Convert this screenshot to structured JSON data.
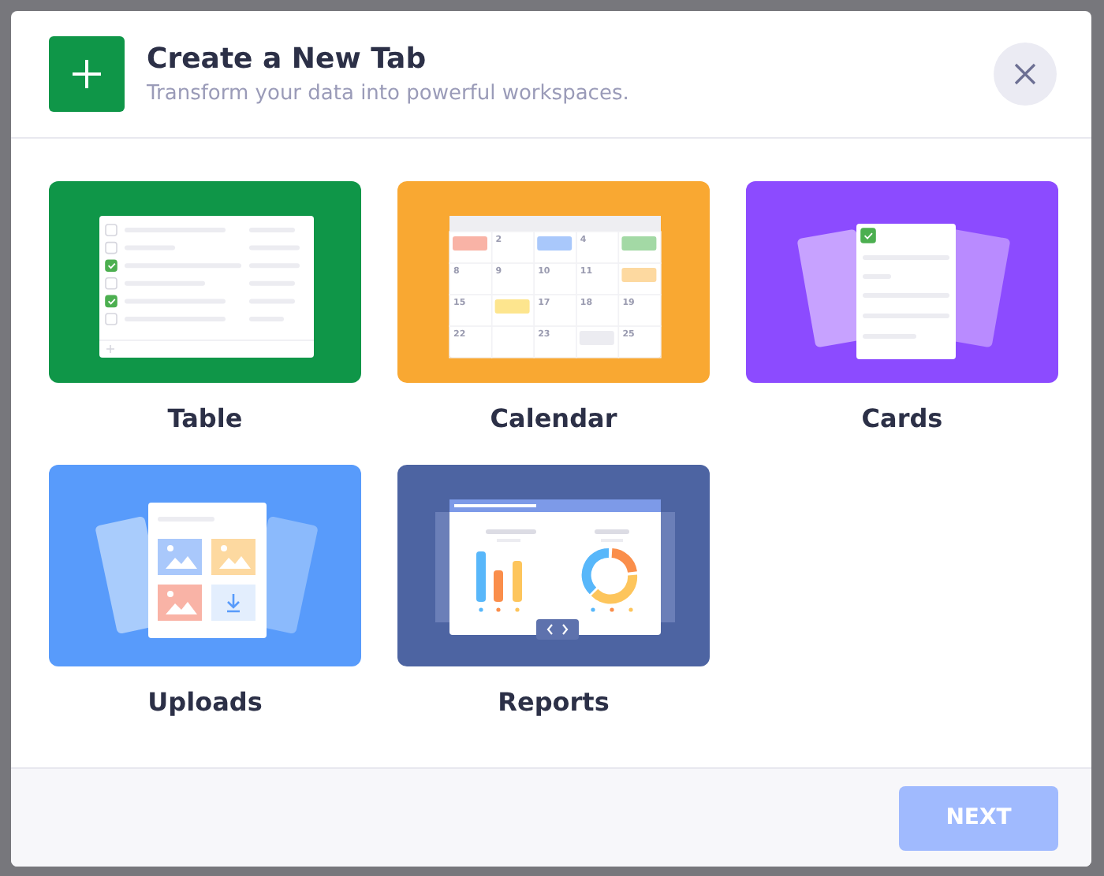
{
  "dialog": {
    "title": "Create a New Tab",
    "subtitle": "Transform your data into powerful workspaces."
  },
  "tiles": [
    {
      "kind": "table",
      "label": "Table",
      "color": "#0f9648",
      "rows": [
        {
          "checked": false
        },
        {
          "checked": false
        },
        {
          "checked": true
        },
        {
          "checked": false
        },
        {
          "checked": true
        },
        {
          "checked": false
        }
      ]
    },
    {
      "kind": "calendar",
      "label": "Calendar",
      "color": "#f9a832",
      "cells": [
        {
          "color": "#f9b3a6"
        },
        {
          "day": "2"
        },
        {
          "color": "#a9c8fb"
        },
        {
          "day": "4"
        },
        {
          "color": "#a3d9a5"
        },
        {
          "day": "8"
        },
        {
          "day": "9"
        },
        {
          "day": "10"
        },
        {
          "day": "11"
        },
        {
          "color": "#fdd9a0"
        },
        {
          "day": "15"
        },
        {
          "color": "#fde58e"
        },
        {
          "day": "17"
        },
        {
          "day": "18"
        },
        {
          "day": "19"
        },
        {
          "day": "22"
        },
        {},
        {
          "day": "23"
        },
        {
          "color": "#ececf1"
        },
        {
          "day": "25"
        }
      ]
    },
    {
      "kind": "cards",
      "label": "Cards",
      "color": "#8c4bff",
      "checked": true
    },
    {
      "kind": "uploads",
      "label": "Uploads",
      "color": "#589bfb"
    },
    {
      "kind": "reports",
      "label": "Reports",
      "color": "#4d64a2"
    }
  ],
  "footer": {
    "next_button": {
      "label": "NEXT",
      "disabled": true
    }
  }
}
